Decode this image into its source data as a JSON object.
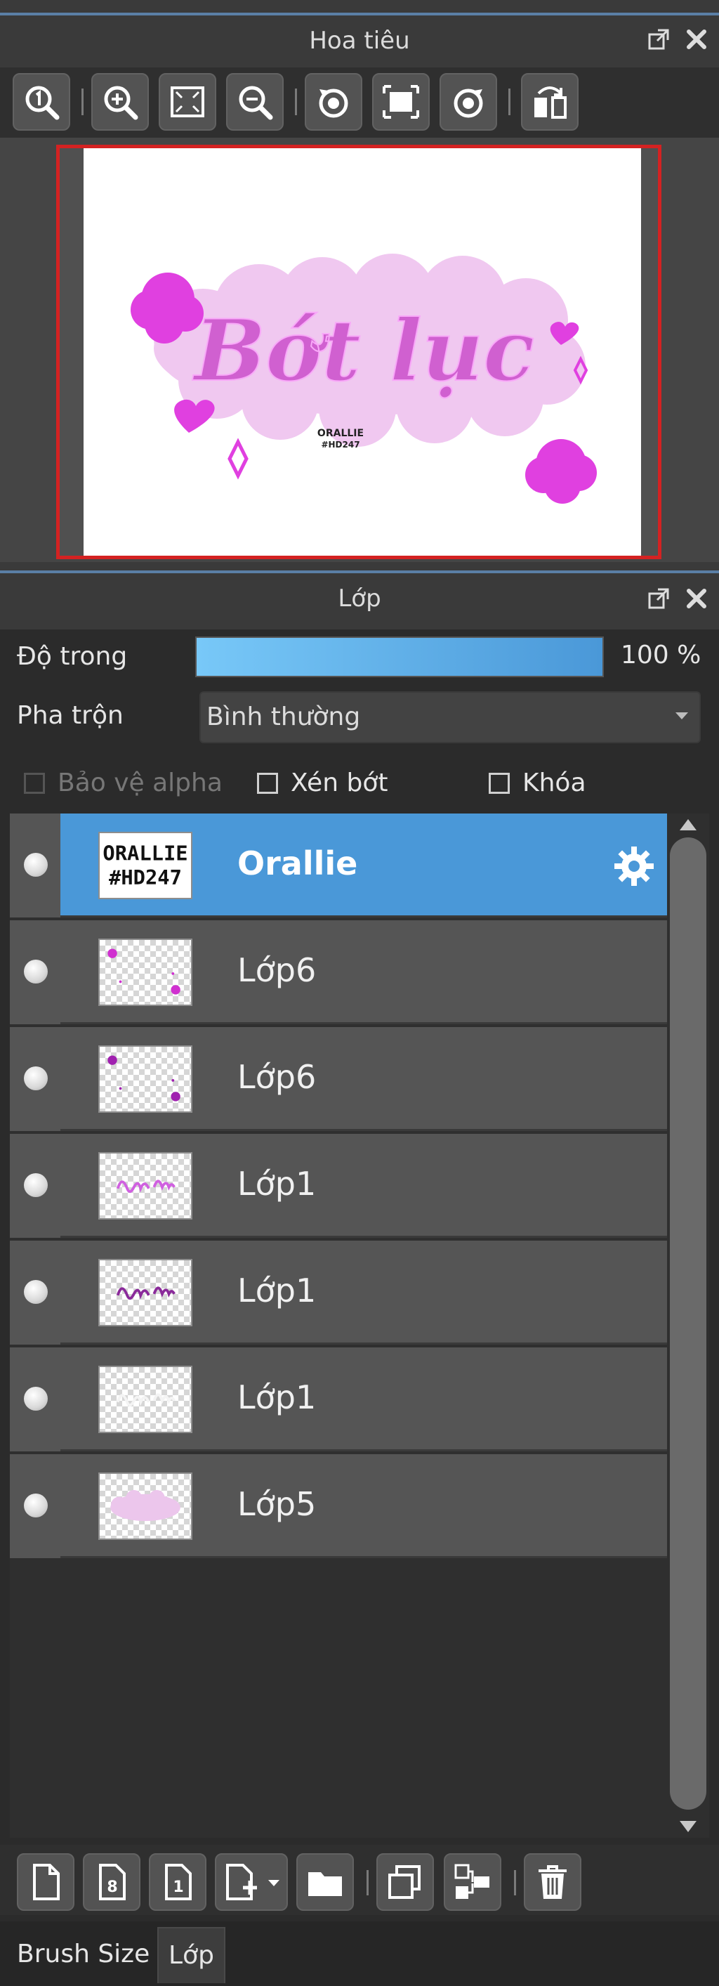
{
  "navigator": {
    "title": "Hoa tiêu",
    "toolbar": [
      "zoom-actual-icon",
      "zoom-in-icon",
      "fit-screen-icon",
      "zoom-out-icon",
      "rotate-left-icon",
      "fit-canvas-icon",
      "rotate-right-icon",
      "flip-horizontal-icon"
    ],
    "preview_text": "Bớt lục",
    "preview_subtext": [
      "ORALLIE",
      "#HD247"
    ],
    "colors": {
      "magenta": "#e040e0",
      "pink_bg": "#f0c8f0",
      "frame": "#d42222"
    }
  },
  "layers": {
    "title": "Lớp",
    "opacity_label": "Độ trong",
    "opacity_value": "100 %",
    "opacity": 1.0,
    "blend_label": "Pha trộn",
    "blend_value": "Bình thường",
    "protect_alpha": "Bảo vệ alpha",
    "clipping": "Xén bớt",
    "lock": "Khóa",
    "items": [
      {
        "name": "Orallie",
        "selected": true,
        "thumb": "text"
      },
      {
        "name": "Lớp6",
        "selected": false,
        "thumb": "dots"
      },
      {
        "name": "Lớp6",
        "selected": false,
        "thumb": "dots"
      },
      {
        "name": "Lớp1",
        "selected": false,
        "thumb": "script"
      },
      {
        "name": "Lớp1",
        "selected": false,
        "thumb": "script"
      },
      {
        "name": "Lớp1",
        "selected": false,
        "thumb": "blank"
      },
      {
        "name": "Lớp5",
        "selected": false,
        "thumb": "cloud"
      }
    ],
    "thumb_text": [
      "ORALLIE",
      "#HD247"
    ],
    "accent": "#4a98d8"
  },
  "bottom_tabs": {
    "brush_size": "Brush Size",
    "layer": "Lớp"
  }
}
